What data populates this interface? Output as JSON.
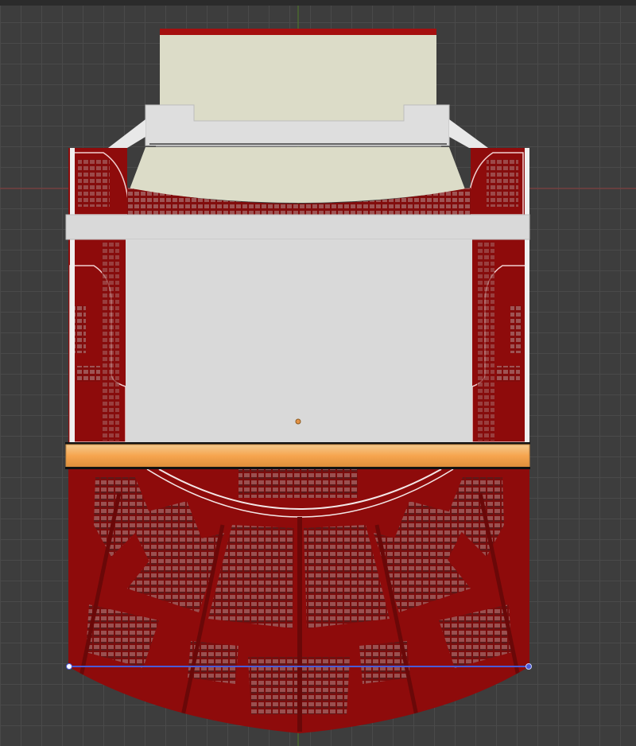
{
  "viewport": {
    "view": "top",
    "background_color": "#3d3d3d",
    "grid_color": "#4a4a4a"
  },
  "model": {
    "name": "theatre-auditorium",
    "seat_color": "#8a3a3a",
    "hall_color": "#8e0b0b",
    "stage_color": "#dcdcc8",
    "gray_surface_color": "#d9d9d9",
    "selected_beam_color": "#f6a54f"
  },
  "axes": {
    "x_axis_color": "#a04040",
    "y_axis_color": "#5a8a2a"
  },
  "measure_line_color": "#4a5bd8"
}
